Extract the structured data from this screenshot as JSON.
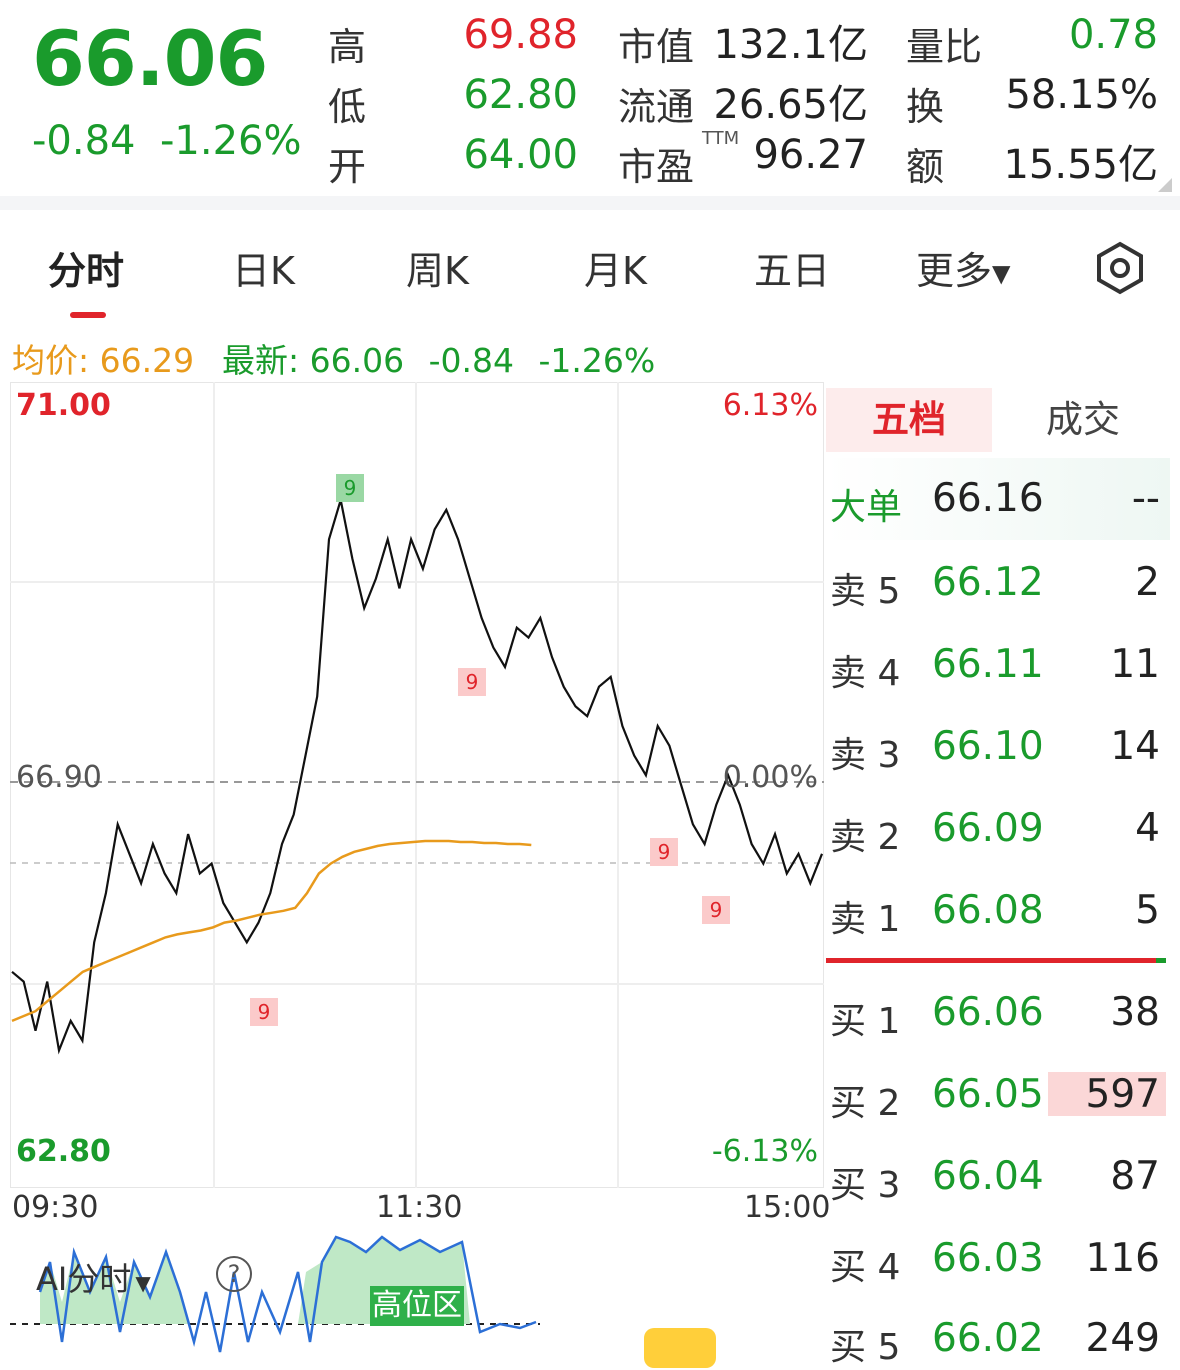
{
  "quote": {
    "last": "66.06",
    "change": "-0.84",
    "change_pct": "-1.26%",
    "high_label": "高",
    "high": "69.88",
    "low_label": "低",
    "low": "62.80",
    "open_label": "开",
    "open": "64.00",
    "mcap_label": "市值",
    "mcap": "132.1亿",
    "float_label": "流通",
    "float": "26.65亿",
    "pe_label": "市盈",
    "pe_sup": "TTM",
    "pe": "96.27",
    "vr_label": "量比",
    "vr": "0.78",
    "turnover_label": "换",
    "turnover": "58.15%",
    "amount_label": "额",
    "amount": "15.55亿"
  },
  "tabs": [
    "分时",
    "日K",
    "周K",
    "月K",
    "五日",
    "更多"
  ],
  "info": {
    "avg_label": "均价:",
    "avg": "66.29",
    "latest_label": "最新:",
    "latest": "66.06",
    "chg": "-0.84",
    "chg_pct": "-1.26%"
  },
  "chart_data": {
    "type": "line",
    "y_top": "71.00",
    "y_bottom": "62.80",
    "y_mid": "66.90",
    "pct_top": "6.13%",
    "pct_mid": "0.00%",
    "pct_bottom": "-6.13%",
    "x_labels": [
      "09:30",
      "11:30",
      "15:00"
    ],
    "ylim": [
      62.8,
      71.0
    ],
    "series": [
      {
        "values": [
          65.0,
          64.9,
          64.4,
          64.9,
          64.2,
          64.5,
          64.3,
          65.3,
          65.8,
          66.5,
          66.2,
          65.9,
          66.3,
          66.0,
          65.8,
          66.4,
          66.0,
          66.1,
          65.7,
          65.5,
          65.3,
          65.5,
          65.8,
          66.3,
          66.6,
          67.2,
          67.8,
          69.4,
          69.8,
          69.2,
          68.7,
          69.0,
          69.4,
          68.9,
          69.4,
          69.1,
          69.5,
          69.7,
          69.4,
          69.0,
          68.6,
          68.3,
          68.1,
          68.5,
          68.4,
          68.6,
          68.2,
          67.9,
          67.7,
          67.6,
          67.9,
          68.0,
          67.5,
          67.2,
          67.0,
          67.5,
          67.3,
          66.9,
          66.5,
          66.3,
          66.7,
          67.0,
          66.7,
          66.3,
          66.1,
          66.4,
          66.0,
          66.2,
          65.9,
          66.2
        ]
      },
      {
        "name": "均价",
        "values": [
          64.5,
          64.55,
          64.6,
          64.7,
          64.8,
          64.9,
          65.0,
          65.05,
          65.1,
          65.15,
          65.2,
          65.25,
          65.3,
          65.35,
          65.38,
          65.4,
          65.42,
          65.45,
          65.5,
          65.52,
          65.55,
          65.58,
          65.6,
          65.62,
          65.65,
          65.8,
          66.0,
          66.1,
          66.17,
          66.22,
          66.25,
          66.28,
          66.3,
          66.31,
          66.32,
          66.33,
          66.33,
          66.33,
          66.32,
          66.32,
          66.31,
          66.31,
          66.3,
          66.3,
          66.29
        ]
      }
    ]
  },
  "orderbook": {
    "tab_active": "五档",
    "tab_other": "成交",
    "big_order_label": "大单",
    "big_order_price": "66.16",
    "big_order_vol": "--",
    "asks": [
      {
        "label": "卖 5",
        "price": "66.12",
        "vol": "2"
      },
      {
        "label": "卖 4",
        "price": "66.11",
        "vol": "11"
      },
      {
        "label": "卖 3",
        "price": "66.10",
        "vol": "14"
      },
      {
        "label": "卖 2",
        "price": "66.09",
        "vol": "4"
      },
      {
        "label": "卖 1",
        "price": "66.08",
        "vol": "5"
      }
    ],
    "bids": [
      {
        "label": "买 1",
        "price": "66.06",
        "vol": "38"
      },
      {
        "label": "买 2",
        "price": "66.05",
        "vol": "597"
      },
      {
        "label": "买 3",
        "price": "66.04",
        "vol": "87"
      },
      {
        "label": "买 4",
        "price": "66.03",
        "vol": "116"
      },
      {
        "label": "买 5",
        "price": "66.02",
        "vol": "249"
      }
    ]
  },
  "indicator": {
    "name": "AI分时",
    "help": "?",
    "zone_label": "高位区"
  },
  "markers": [
    "9",
    "9",
    "9",
    "9",
    "9"
  ],
  "colors": {
    "up": "#e0242b",
    "down": "#1a9b2c",
    "avg_line": "#e89a1c"
  }
}
